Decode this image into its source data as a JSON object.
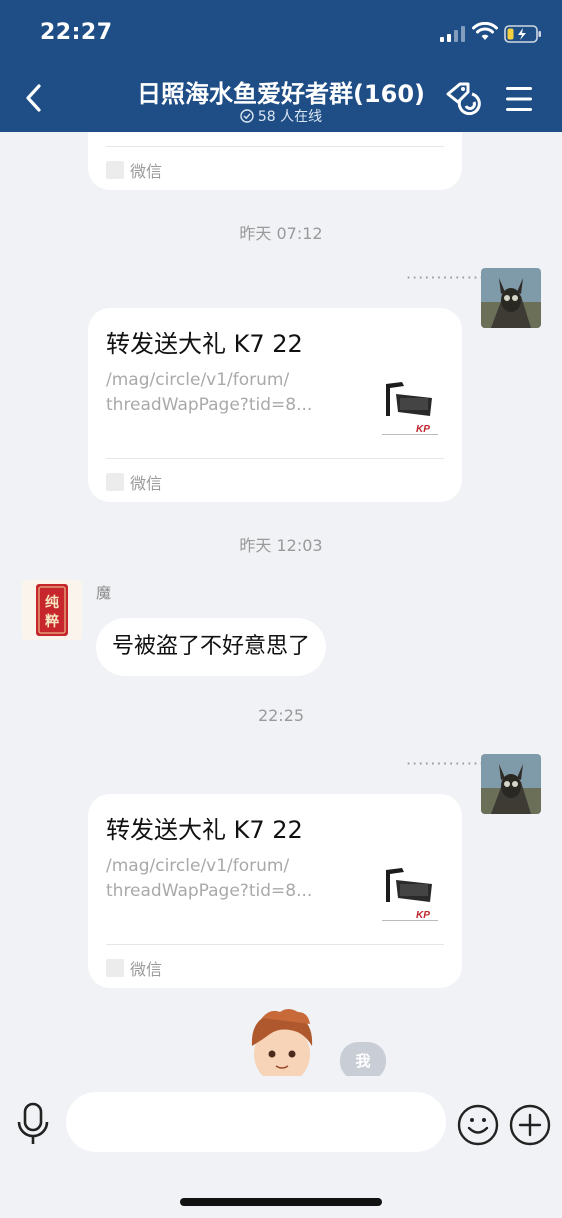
{
  "status": {
    "time": "22:27"
  },
  "header": {
    "title": "日照海水鱼爱好者群(160)",
    "online_text": "58 人在线"
  },
  "messages": {
    "partial_card": {
      "source": "微信"
    },
    "ts1": "昨天 07:12",
    "card1": {
      "title": "转发送大礼 K7 22",
      "desc_line1": "/mag/circle/v1/forum/",
      "desc_line2": "threadWapPage?tid=8...",
      "source": "微信",
      "status_dots": "·············"
    },
    "ts2": "昨天 12:03",
    "sender": {
      "name": "魔",
      "avatar_text": "纯粹",
      "text": "号被盗了不好意思了"
    },
    "ts3": "22:25",
    "card2": {
      "title": "转发送大礼 K7 22",
      "desc_line1": "/mag/circle/v1/forum/",
      "desc_line2": "threadWapPage?tid=8...",
      "source": "微信",
      "status_dots": "·············"
    },
    "me_chip": "我"
  },
  "input": {
    "placeholder": ""
  },
  "icons": {
    "back": "chevron-left-icon",
    "tag": "tag-swap-icon",
    "menu": "hamburger-menu-icon",
    "mic": "microphone-icon",
    "emoji": "smiley-icon",
    "plus": "plus-circle-icon"
  },
  "colors": {
    "header_bg": "#1f4e86",
    "chat_bg": "#f0f2f5"
  }
}
